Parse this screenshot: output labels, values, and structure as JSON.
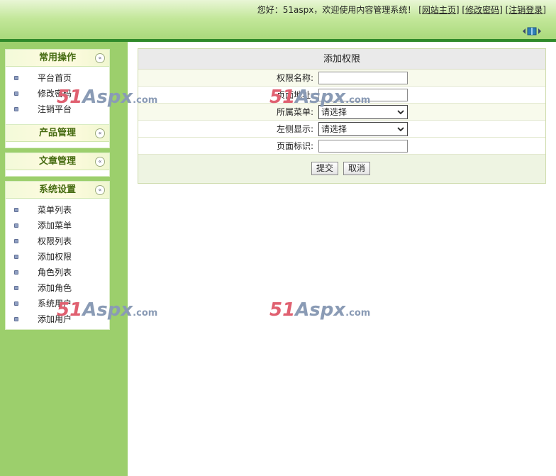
{
  "header": {
    "greeting": "您好：51aspx，欢迎使用内容管理系统！",
    "links": [
      "[网站主页]",
      "[修改密码]",
      "[注销登录]"
    ],
    "toggle_icon": "sidebar-toggle-icon"
  },
  "sidebar": {
    "sections": [
      {
        "title": "常用操作",
        "items": [
          "平台首页",
          "修改密码",
          "注销平台"
        ]
      },
      {
        "title": "产品管理",
        "items": []
      },
      {
        "title": "文章管理",
        "items": []
      },
      {
        "title": "系统设置",
        "items": [
          "菜单列表",
          "添加菜单",
          "权限列表",
          "添加权限",
          "角色列表",
          "添加角色",
          "系统用户",
          "添加用户"
        ]
      }
    ],
    "collapse_glyph": "«"
  },
  "form": {
    "title": "添加权限",
    "fields": [
      {
        "label": "权限名称:",
        "type": "text",
        "value": ""
      },
      {
        "label": "页面地址:",
        "type": "text",
        "value": ""
      },
      {
        "label": "所属菜单:",
        "type": "select",
        "value": "请选择"
      },
      {
        "label": "左侧显示:",
        "type": "select",
        "value": "请选择"
      },
      {
        "label": "页面标识:",
        "type": "text",
        "value": ""
      }
    ],
    "submit_label": "提交",
    "cancel_label": "取消"
  },
  "watermark": {
    "num": "51",
    "text": "Aspx",
    "suffix": ".com"
  },
  "colors": {
    "sidebar_bg": "#9ccf6c",
    "header_line": "#2f8a2a",
    "section_title": "#466b11",
    "watermark_red": "#e06070"
  }
}
